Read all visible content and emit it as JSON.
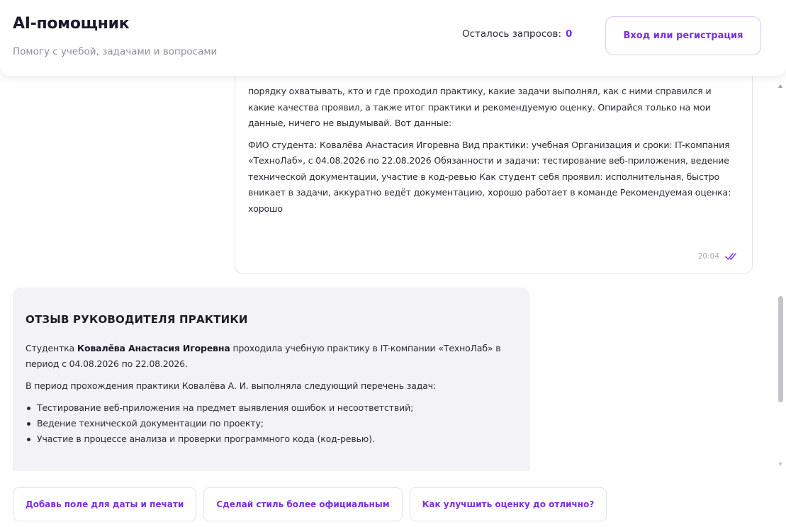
{
  "header": {
    "title": "AI-помощник",
    "subtitle": "Помогу с учебой, задачами и вопросами",
    "quota_label": "Осталось запросов:",
    "quota_count": "0",
    "login_label": "Вход или регистрация"
  },
  "user_message": {
    "paragraphs": [
      "порядку охватывать, кто и где проходил практику, какие задачи выполнял, как с ними справился и какие качества проявил, а также итог практики и рекомендуемую оценку. Опирайся только на мои данные, ничего не выдумывай. Вот данные:",
      "ФИО студента: Ковалёва Анастасия Игоревна Вид практики: учебная Организация и сроки: IT-компания «ТехноЛаб», с 04.08.2026 по 22.08.2026 Обязанности и задачи: тестирование веб-приложения, ведение технической документации, участие в код-ревью Как студент себя проявил: исполнительная, быстро вникает в задачи, аккуратно ведёт документацию, хорошо работает в команде Рекомендуемая оценка: хорошо"
    ],
    "time": "20:04",
    "status_icon": "double-check-icon",
    "status_color": "#8a3ffc"
  },
  "bot_message": {
    "title": "ОТЗЫВ РУКОВОДИТЕЛЯ ПРАКТИКИ",
    "intro_before": "Студентка ",
    "intro_name": "Ковалёва Анастасия Игоревна",
    "intro_after": " проходила учебную практику в IT-компании «ТехноЛаб» в период с 04.08.2026 по 22.08.2026.",
    "tasks_intro": "В период прохождения практики Ковалёва А. И. выполняла следующий перечень задач:",
    "tasks": [
      "Тестирование веб-приложения на предмет выявления ошибок и несоответствий;",
      "Ведение технической документации по проекту;",
      "Участие в процессе анализа и проверки программного кода (код-ревью)."
    ]
  },
  "suggestions": [
    "Добавь поле для даты и печати",
    "Сделай стиль более официальным",
    "Как улучшить оценку до отлично?"
  ],
  "colors": {
    "accent": "#7a2ee0",
    "bot_bubble": "#f2f2f7",
    "muted_text": "#8c8c9c"
  }
}
